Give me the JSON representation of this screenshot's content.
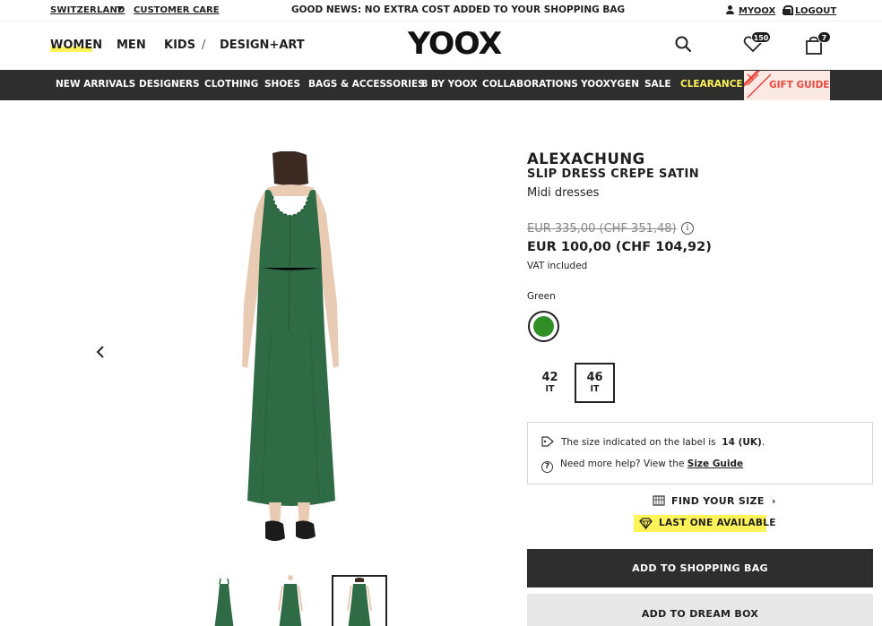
{
  "topbar": {
    "country": "SWITZERLAND",
    "customer_care": "CUSTOMER CARE",
    "promo": "GOOD NEWS: NO EXTRA COST ADDED TO YOUR SHOPPING BAG",
    "myoox": "MYOOX",
    "logout": "LOGOUT"
  },
  "header": {
    "nav": [
      "WOMEN",
      "MEN",
      "KIDS",
      "/",
      "DESIGN+ART"
    ],
    "active_nav": "WOMEN",
    "logo": "YOOX",
    "wishlist_count": "150",
    "bag_count": "7",
    "icons": [
      "search-icon",
      "heart-icon",
      "shopping-bag-icon"
    ]
  },
  "categories": [
    "NEW ARRIVALS",
    "DESIGNERS",
    "CLOTHING",
    "SHOES",
    "BAGS & ACCESSORIES",
    "8 BY YOOX",
    "COLLABORATIONS",
    "YOOXYGEN",
    "SALE",
    "CLEARANCE"
  ],
  "gift_guide": "GIFT GUIDE",
  "colors": {
    "accent_yellow": "#fff35a",
    "dark_bar": "#2e2e2e",
    "gift_red": "#e8453c",
    "gift_bg": "#fde9e4",
    "dress_green": "#2f6b45",
    "swatch_green": "#2f8f24"
  },
  "product": {
    "brand": "ALEXACHUNG",
    "name": "SLIP DRESS CREPE SATIN",
    "type": "Midi dresses",
    "old_price": "EUR 335,00 (CHF 351,48)",
    "new_price": "EUR 100,00 (CHF 104,92)",
    "vat": "VAT included",
    "color_label": "Green",
    "sizes": [
      {
        "n": "42",
        "u": "IT"
      },
      {
        "n": "46",
        "u": "IT"
      }
    ],
    "selected_size": "46",
    "size_note_prefix": "The size indicated on the label is",
    "size_note_value": "14 (UK)",
    "size_note_suffix": ".",
    "help_prefix": "Need more help? View the",
    "help_link": "Size Guide",
    "find_size": "FIND YOUR SIZE",
    "last_one": "LAST ONE AVAILABLE",
    "add_to_bag": "ADD TO SHOPPING BAG",
    "add_to_dream": "ADD TO DREAM BOX"
  }
}
